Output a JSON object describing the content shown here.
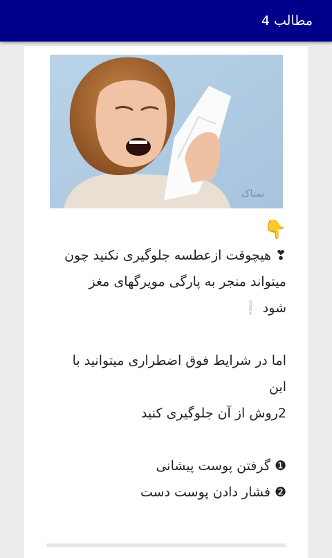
{
  "appbar": {
    "title": "مطالب 4"
  },
  "article": {
    "image_icon": "sneezing-woman-photo",
    "watermark_text": "نمناک",
    "pointer_emoji": "👇",
    "line1": "❣ هیچوقت ازعطسه جلوگیری نکنید چون",
    "line2": "میتواند منجر به پارگی مویرگهای مغز",
    "line3": "شود ❕",
    "line4": "اما در شرایط فوق اضطراری میتوانید با این",
    "line5": "2روش از آن جلوگیری کنید",
    "line6": "❶ گرفتن پوست پیشانی",
    "line7": "❷ فشار دادن پوست دست"
  },
  "colors": {
    "appbar": "#00008b",
    "background": "#ececec",
    "card": "#ffffff"
  }
}
